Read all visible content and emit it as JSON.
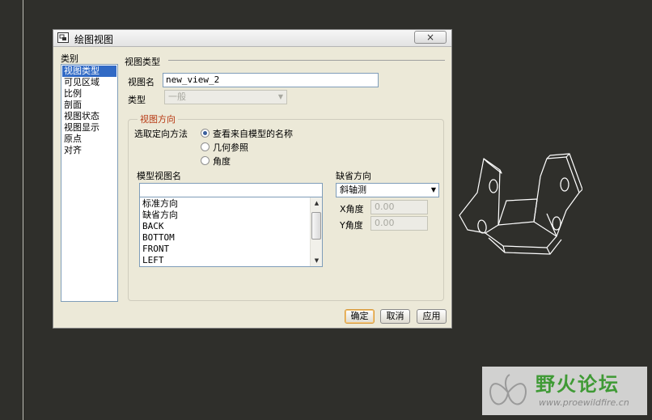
{
  "dialog": {
    "title": "绘图视图",
    "close_label": "×"
  },
  "categories": {
    "label": "类别",
    "items": [
      "视图类型",
      "可见区域",
      "比例",
      "剖面",
      "视图状态",
      "视图显示",
      "原点",
      "对齐"
    ],
    "selected": "视图类型"
  },
  "view_type": {
    "section_title": "视图类型",
    "view_name_label": "视图名",
    "view_name_value": "new_view_2",
    "type_label": "类型",
    "type_value": "一般"
  },
  "orientation": {
    "group_title": "视图方向",
    "method_label": "选取定向方法",
    "options": [
      "查看来自模型的名称",
      "几何参照",
      "角度"
    ],
    "selected_option": "查看来自模型的名称",
    "model_views_label": "模型视图名",
    "model_views_filter": "",
    "model_views": [
      "标准方向",
      "缺省方向",
      "BACK",
      "BOTTOM",
      "FRONT",
      "LEFT"
    ],
    "default_orientation_label": "缺省方向",
    "default_orientation_value": "斜轴测",
    "x_angle_label": "X角度",
    "x_angle_value": "0.00",
    "y_angle_label": "Y角度",
    "y_angle_value": "0.00"
  },
  "buttons": {
    "ok": "确定",
    "cancel": "取消",
    "apply": "应用"
  },
  "watermark": {
    "title": "野火论坛",
    "url": "www.proewildfire.cn"
  }
}
